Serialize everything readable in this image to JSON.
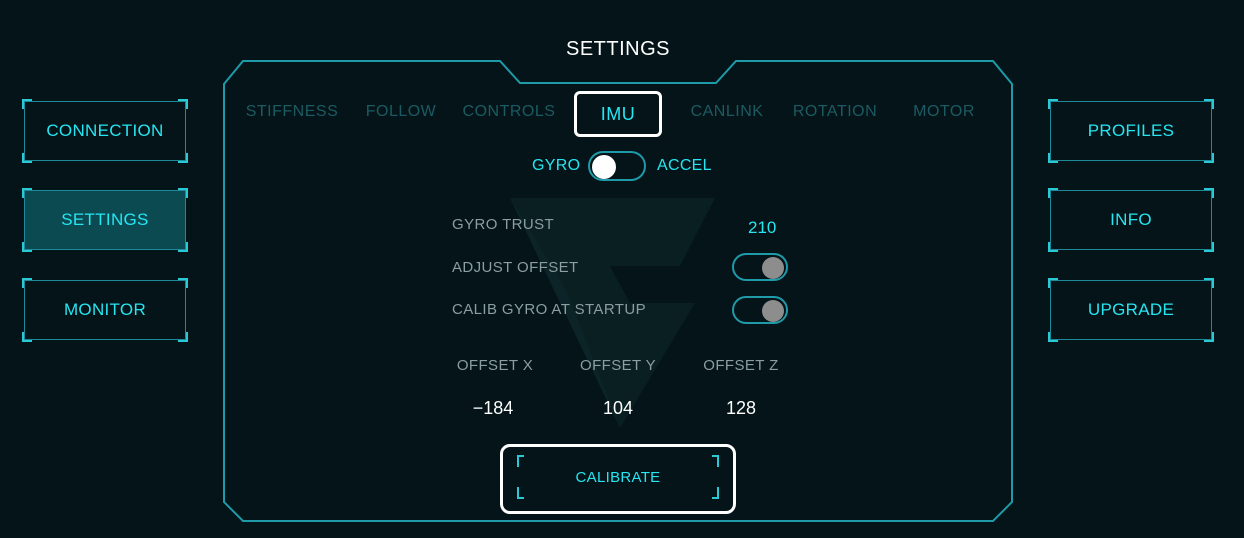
{
  "header": {
    "title": "SETTINGS"
  },
  "left_nav": {
    "items": [
      {
        "label": "CONNECTION",
        "active": false
      },
      {
        "label": "SETTINGS",
        "active": true
      },
      {
        "label": "MONITOR",
        "active": false
      }
    ]
  },
  "right_nav": {
    "items": [
      {
        "label": "PROFILES"
      },
      {
        "label": "INFO"
      },
      {
        "label": "UPGRADE"
      }
    ]
  },
  "tabs": [
    {
      "label": "STIFFNESS"
    },
    {
      "label": "FOLLOW"
    },
    {
      "label": "CONTROLS"
    },
    {
      "label": "IMU",
      "active": true
    },
    {
      "label": "CANLINK"
    },
    {
      "label": "ROTATION"
    },
    {
      "label": "MOTOR"
    }
  ],
  "imu": {
    "mode_left": "GYRO",
    "mode_right": "ACCEL",
    "mode_selected": "GYRO",
    "gyro_trust_label": "GYRO TRUST",
    "gyro_trust_value": "210",
    "adjust_offset_label": "ADJUST OFFSET",
    "adjust_offset_on": true,
    "calib_startup_label": "CALIB GYRO AT STARTUP",
    "calib_startup_on": true,
    "offsets": [
      {
        "label": "OFFSET X",
        "value": "−184"
      },
      {
        "label": "OFFSET Y",
        "value": "104"
      },
      {
        "label": "OFFSET Z",
        "value": "128"
      }
    ],
    "calibrate_label": "CALIBRATE"
  },
  "colors": {
    "background": "#041418",
    "accent": "#26e6f2",
    "frame": "#1e9aa8",
    "inactive_tab": "#1c5b63",
    "active_nav_fill": "#0c4a52"
  }
}
